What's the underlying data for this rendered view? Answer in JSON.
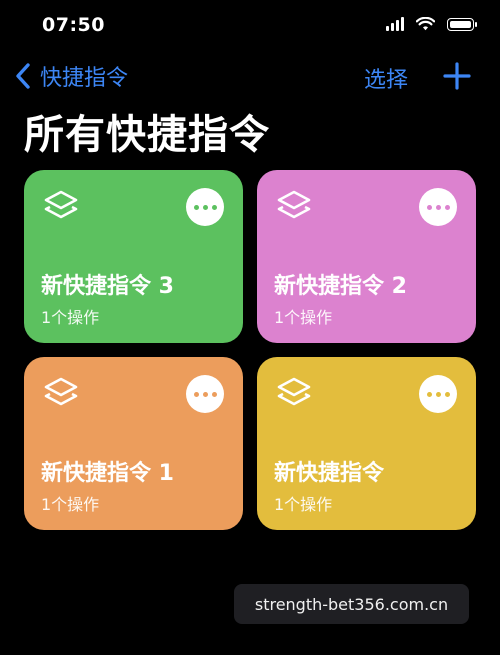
{
  "status_bar": {
    "time": "07:50"
  },
  "nav": {
    "back_label": "快捷指令",
    "select_label": "选择",
    "accent_color": "#3d86f5"
  },
  "page": {
    "title": "所有快捷指令"
  },
  "shortcuts": [
    {
      "title": "新快捷指令 3",
      "subtitle": "1个操作",
      "color": "#5cc15f",
      "icon": "layers-icon"
    },
    {
      "title": "新快捷指令 2",
      "subtitle": "1个操作",
      "color": "#dc82cf",
      "icon": "layers-icon"
    },
    {
      "title": "新快捷指令 1",
      "subtitle": "1个操作",
      "color": "#ec9d5c",
      "icon": "layers-icon"
    },
    {
      "title": "新快捷指令",
      "subtitle": "1个操作",
      "color": "#e3bd3d",
      "icon": "layers-icon"
    }
  ],
  "watermark": {
    "text": "strength-bet356.com.cn"
  }
}
